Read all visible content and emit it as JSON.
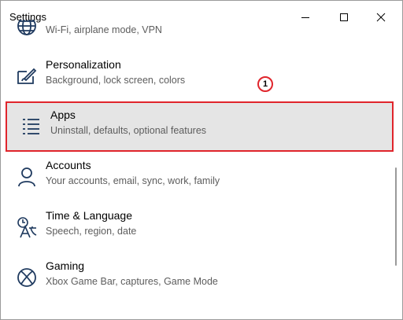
{
  "window": {
    "title": "Settings"
  },
  "items": [
    {
      "label": "",
      "desc": "Wi-Fi, airplane mode, VPN",
      "icon": "globe-icon"
    },
    {
      "label": "Personalization",
      "desc": "Background, lock screen, colors",
      "icon": "personalization-icon"
    },
    {
      "label": "Apps",
      "desc": "Uninstall, defaults, optional features",
      "icon": "apps-list-icon"
    },
    {
      "label": "Accounts",
      "desc": "Your accounts, email, sync, work, family",
      "icon": "person-icon"
    },
    {
      "label": "Time & Language",
      "desc": "Speech, region, date",
      "icon": "time-language-icon"
    },
    {
      "label": "Gaming",
      "desc": "Xbox Game Bar, captures, Game Mode",
      "icon": "xbox-icon"
    }
  ],
  "annotation": {
    "step_number": "1"
  },
  "colors": {
    "highlight_border": "#e0252c",
    "selected_bg": "#e5e5e5",
    "icon": "#1f3a5f"
  }
}
